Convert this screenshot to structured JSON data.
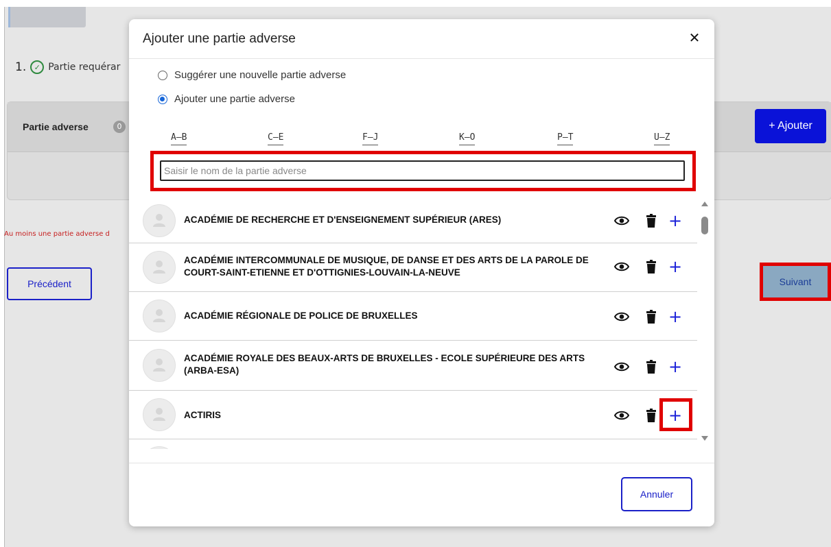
{
  "background": {
    "step": {
      "number": "1.",
      "label": "Partie requérar"
    },
    "section": {
      "title": "Partie adverse",
      "count": "0"
    },
    "add_button": "+ Ajouter",
    "warning": "Au moins une partie adverse d",
    "previous_button": "Précédent",
    "next_button": "Suivant"
  },
  "modal": {
    "title": "Ajouter une partie adverse",
    "close_icon": "close-icon",
    "radio_options": [
      {
        "label": "Suggérer une nouvelle partie adverse",
        "checked": false
      },
      {
        "label": "Ajouter une partie adverse",
        "checked": true
      }
    ],
    "alphabet_filters": [
      "A–B",
      "C–E",
      "F–J",
      "K–O",
      "P–T",
      "U–Z"
    ],
    "search": {
      "placeholder": "Saisir le nom de la partie adverse",
      "value": ""
    },
    "parties": [
      {
        "name": "ACADÉMIE DE RECHERCHE ET D'ENSEIGNEMENT SUPÉRIEUR (ARES)"
      },
      {
        "name": "ACADÉMIE INTERCOMMUNALE DE MUSIQUE, DE DANSE ET DES ARTS DE LA PAROLE DE COURT-SAINT-ETIENNE ET D'OTTIGNIES-LOUVAIN-LA-NEUVE"
      },
      {
        "name": "ACADÉMIE RÉGIONALE DE POLICE DE BRUXELLES"
      },
      {
        "name": "ACADÉMIE ROYALE DES BEAUX-ARTS DE BRUXELLES - ECOLE SUPÉRIEURE DES ARTS (ARBA-ESA)"
      },
      {
        "name": "ACTIRIS"
      }
    ],
    "row_actions": [
      "eye-icon",
      "trash-icon",
      "plus-icon"
    ],
    "cancel_button": "Annuler"
  },
  "colors": {
    "primary_blue": "#1a20d8",
    "highlight_red": "#e00000",
    "overlay_gray": "#e6e6e6"
  }
}
